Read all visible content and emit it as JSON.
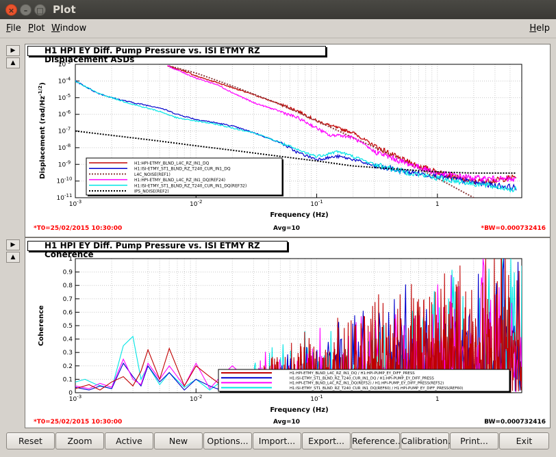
{
  "window": {
    "title": "Plot",
    "close_glyph": "×",
    "min_glyph": "–",
    "max_glyph": "□"
  },
  "menubar": {
    "file": {
      "underline": "F",
      "rest": "ile"
    },
    "plot": {
      "underline": "P",
      "rest": "lot"
    },
    "window": {
      "underline": "W",
      "rest": "indow"
    },
    "help": {
      "underline": "H",
      "rest": "elp"
    }
  },
  "side_arrows": {
    "right": "▶",
    "up": "▲"
  },
  "pads": [
    {
      "title": "H1 HPI EY Diff. Pump Pressure vs. ISI ETMY RZ Displacement ASDs",
      "t0": "*T0=25/02/2015 10:30:00",
      "avg": "Avg=10",
      "bw": "*BW=0.000732416",
      "bw_color": "#ff0000",
      "xlabel": "Frequency (Hz)",
      "ylabel": "Displacement (rad/Hz",
      "ylabel_sup": "-1/2",
      "ylabel_close": ")"
    },
    {
      "title": "H1 HPI EY Diff. Pump Pressure vs. ISI ETMY RZ Coherence",
      "t0": "*T0=25/02/2015 10:30:00",
      "avg": "Avg=10",
      "bw": "BW=0.000732416",
      "bw_color": "#000000",
      "xlabel": "Frequency (Hz)",
      "ylabel": "Coherence"
    }
  ],
  "chart_data": [
    {
      "type": "line",
      "scale": "log-log",
      "xlim": [
        0.001,
        5
      ],
      "ylim": [
        1e-11,
        0.001
      ],
      "x_ticks": [
        "10",
        "10",
        "10",
        "1"
      ],
      "x_tick_exp": [
        "-3",
        "-2",
        "-1",
        ""
      ],
      "y_ticks": [
        "10",
        "10",
        "10",
        "10",
        "10",
        "10",
        "10",
        "10",
        "10"
      ],
      "y_tick_exp": [
        "-3",
        "-4",
        "-5",
        "-6",
        "-7",
        "-8",
        "-9",
        "-10",
        "-11"
      ],
      "grid": true,
      "legend_position": "bottom-left",
      "series": [
        {
          "name": "H1:HPI-ETMY_BLND_L4C_RZ_IN1_DQ",
          "color": "#c00000",
          "style": "solid",
          "x": [
            0.0058,
            0.008,
            0.01,
            0.015,
            0.02,
            0.03,
            0.05,
            0.07,
            0.1,
            0.15,
            0.2,
            0.3,
            0.5,
            0.7,
            1,
            1.5,
            2,
            3,
            4.5
          ],
          "y": [
            0.0008,
            0.0004,
            0.0002,
            8e-05,
            4e-05,
            1.5e-05,
            4e-06,
            1.6e-06,
            4e-07,
            1.5e-07,
            8e-08,
            1.3e-08,
            2e-09,
            8e-10,
            3.5e-10,
            1.5e-10,
            9e-11,
            1.1e-10,
            1.8e-10
          ]
        },
        {
          "name": "H1:ISI-ETMY_ST1_BLND_RZ_T240_CUR_IN1_DQ",
          "color": "#0000cc",
          "style": "solid",
          "x": [
            0.001,
            0.0015,
            0.002,
            0.003,
            0.005,
            0.007,
            0.01,
            0.015,
            0.02,
            0.03,
            0.05,
            0.07,
            0.1,
            0.15,
            0.2,
            0.3,
            0.5,
            1,
            2,
            4.5
          ],
          "y": [
            0.0001,
            2e-05,
            1e-05,
            5e-06,
            2.5e-06,
            1e-06,
            5e-07,
            3e-07,
            2e-07,
            8e-08,
            2e-08,
            5e-09,
            2e-09,
            3e-09,
            2e-09,
            8e-10,
            4e-10,
            2e-10,
            8e-11,
            4e-11
          ]
        },
        {
          "name": "L4C_NOISE(REF1)",
          "color": "#8b3a3a",
          "style": "dotted",
          "x": [
            0.006,
            0.01,
            0.02,
            0.05,
            0.1,
            0.2,
            0.5,
            1,
            2
          ],
          "y": [
            0.0008,
            0.0003,
            5e-05,
            4e-06,
            4e-07,
            4e-08,
            2e-09,
            1.5e-10,
            1e-11
          ]
        },
        {
          "name": "H1:HPI-ETMY_BLND_L4C_RZ_IN1_DQ(REF24)",
          "color": "#ff00ff",
          "style": "solid",
          "x": [
            0.0058,
            0.008,
            0.01,
            0.015,
            0.02,
            0.03,
            0.05,
            0.07,
            0.1,
            0.13,
            0.15,
            0.2,
            0.3,
            0.5,
            1,
            2,
            4.5
          ],
          "y": [
            0.0008,
            0.0003,
            0.00015,
            6e-05,
            2e-05,
            5e-06,
            1.5e-06,
            6e-07,
            1.5e-07,
            5e-08,
            6e-08,
            4e-08,
            6e-09,
            1.5e-09,
            3e-10,
            1.5e-10,
            1.2e-10
          ]
        },
        {
          "name": "H1:ISI-ETMY_ST1_BLND_RZ_T240_CUR_IN1_DQ(REF32)",
          "color": "#00e5e5",
          "style": "solid",
          "x": [
            0.001,
            0.0015,
            0.002,
            0.003,
            0.005,
            0.007,
            0.01,
            0.015,
            0.02,
            0.03,
            0.05,
            0.07,
            0.1,
            0.15,
            0.2,
            0.3,
            0.5,
            1,
            2,
            4.5
          ],
          "y": [
            0.0001,
            2e-05,
            1e-05,
            4e-06,
            1.5e-06,
            6e-07,
            4e-07,
            2.5e-07,
            1.5e-07,
            8e-08,
            2e-08,
            7e-09,
            3e-09,
            6e-09,
            3e-09,
            1e-09,
            4e-10,
            1.5e-10,
            7e-11,
            3e-11
          ]
        },
        {
          "name": "IPS_NOISE(REF2)",
          "color": "#000000",
          "style": "dotted",
          "x": [
            0.001,
            0.002,
            0.005,
            0.01,
            0.02,
            0.05,
            0.1,
            0.2,
            0.5,
            1,
            2,
            4.5
          ],
          "y": [
            1e-07,
            5.5e-08,
            2.5e-08,
            1.3e-08,
            7e-09,
            3e-09,
            1.6e-09,
            8e-10,
            5e-10,
            3.5e-10,
            3e-10,
            3e-10
          ]
        }
      ]
    },
    {
      "type": "line",
      "scale": "log-x",
      "xlim": [
        0.001,
        5
      ],
      "ylim": [
        0,
        1
      ],
      "x_ticks": [
        "10",
        "10",
        "10",
        "1"
      ],
      "x_tick_exp": [
        "-3",
        "-2",
        "-1",
        ""
      ],
      "y_ticks": [
        "1",
        "0.9",
        "0.8",
        "0.7",
        "0.6",
        "0.5",
        "0.4",
        "0.3",
        "0.2",
        "0.1",
        "0"
      ],
      "grid": true,
      "legend_position": "bottom-right",
      "series": [
        {
          "name": "H1:HPI-ETMY_BLND_L4C_RZ_IN1_DQ / H1:HPI-PUMP_EY_DIFF_PRESS",
          "color": "#c00000",
          "style": "solid",
          "x": [
            0.001,
            0.0013,
            0.0016,
            0.002,
            0.0025,
            0.003,
            0.0035,
            0.004,
            0.005,
            0.006,
            0.007,
            0.008,
            0.01,
            0.013,
            0.016,
            0.02,
            0.03
          ],
          "y": [
            0.03,
            0.06,
            0.02,
            0.08,
            0.12,
            0.05,
            0.16,
            0.32,
            0.1,
            0.33,
            0.18,
            0.05,
            0.2,
            0.12,
            0.06,
            0.14,
            0.04
          ]
        },
        {
          "name": "H1:ISI-ETMY_ST1_BLND_RZ_T240_CUR_IN1_DQ / H1:HPI-PUMP_EY_DIFF_PRESS",
          "color": "#0000cc",
          "style": "solid",
          "x": [
            0.001,
            0.0013,
            0.0016,
            0.002,
            0.0025,
            0.003,
            0.0035,
            0.004,
            0.005,
            0.006,
            0.008,
            0.01,
            0.013,
            0.016
          ],
          "y": [
            0.04,
            0.02,
            0.05,
            0.03,
            0.22,
            0.12,
            0.05,
            0.2,
            0.08,
            0.15,
            0.02,
            0.1,
            0.05,
            0.02
          ]
        },
        {
          "name": "H1:HPI-ETMY_BLND_L4C_RZ_IN1_DQ(REF52) / H1:HPI-PUMP_EY_DIFF_PRESS(REF52)",
          "color": "#ff00ff",
          "style": "solid",
          "x": [
            0.001,
            0.0013,
            0.0016,
            0.002,
            0.0025,
            0.003,
            0.0035,
            0.004,
            0.005,
            0.006,
            0.008,
            0.01,
            0.013,
            0.016,
            0.02,
            0.03
          ],
          "y": [
            0.05,
            0.03,
            0.07,
            0.04,
            0.25,
            0.1,
            0.06,
            0.22,
            0.1,
            0.2,
            0.05,
            0.22,
            0.03,
            0.12,
            0.2,
            0.06
          ]
        },
        {
          "name": "H1:ISI-ETMY_ST1_BLND_RZ_T240_CUR_IN1_DQ(REF60) / H1:HPI-PUMP_EY_DIFF_PRESS(REF60)",
          "color": "#00e5e5",
          "style": "solid",
          "x": [
            0.001,
            0.0012,
            0.0015,
            0.002,
            0.0025,
            0.003,
            0.0035,
            0.004,
            0.005,
            0.006,
            0.008,
            0.01,
            0.013,
            0.016,
            0.02,
            0.03
          ],
          "y": [
            0.08,
            0.1,
            0.06,
            0.03,
            0.35,
            0.42,
            0.1,
            0.2,
            0.06,
            0.15,
            0.04,
            0.1,
            0.02,
            0.08,
            0.1,
            0.03
          ]
        }
      ]
    }
  ],
  "buttons": [
    "Reset",
    "Zoom",
    "Active",
    "New",
    "Options...",
    "Import...",
    "Export...",
    "Reference...",
    "Calibration...",
    "Print...",
    "Exit"
  ]
}
